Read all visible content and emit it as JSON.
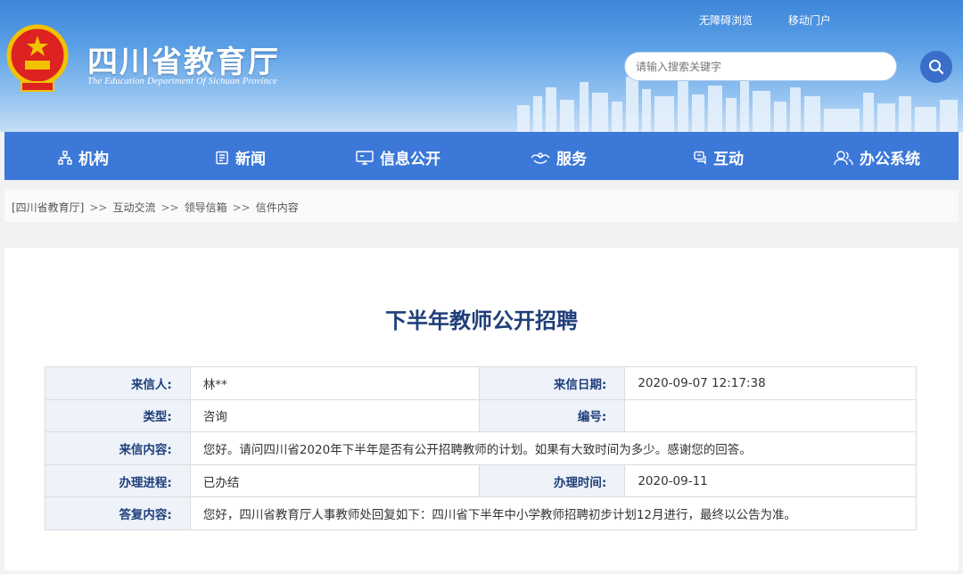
{
  "header": {
    "title": "四川省教育厅",
    "subtitle": "The Education Department Of Sichuan Province",
    "top_links": [
      "无障碍浏览",
      "移动门户"
    ],
    "search_placeholder": "请输入搜索关键字"
  },
  "nav": {
    "items": [
      {
        "label": "机构",
        "icon": "org-icon"
      },
      {
        "label": "新闻",
        "icon": "news-icon"
      },
      {
        "label": "信息公开",
        "icon": "monitor-icon"
      },
      {
        "label": "服务",
        "icon": "service-icon"
      },
      {
        "label": "互动",
        "icon": "chat-icon"
      },
      {
        "label": "办公系统",
        "icon": "users-icon"
      }
    ]
  },
  "breadcrumb": [
    "[四川省教育厅]",
    "互动交流",
    "领导信箱",
    "信件内容"
  ],
  "breadcrumb_sep": ">>",
  "letter": {
    "title": "下半年教师公开招聘",
    "sender_label": "来信人:",
    "sender": "林**",
    "date_label": "来信日期:",
    "date": "2020-09-07 12:17:38",
    "type_label": "类型:",
    "type": "咨询",
    "number_label": "编号:",
    "number": "",
    "content_label": "来信内容:",
    "content": "您好。请问四川省2020年下半年是否有公开招聘教师的计划。如果有大致时间为多少。感谢您的回答。",
    "progress_label": "办理进程:",
    "progress": "已办结",
    "handle_time_label": "办理时间:",
    "handle_time": "2020-09-11",
    "reply_label": "答复内容:",
    "reply": "您好，四川省教育厅人事教师处回复如下：四川省下半年中小学教师招聘初步计划12月进行，最终以公告为准。"
  },
  "colors": {
    "nav_bg": "#3b78d8",
    "title_text": "#1f3e7a",
    "label_bg": "#eef3fa"
  }
}
